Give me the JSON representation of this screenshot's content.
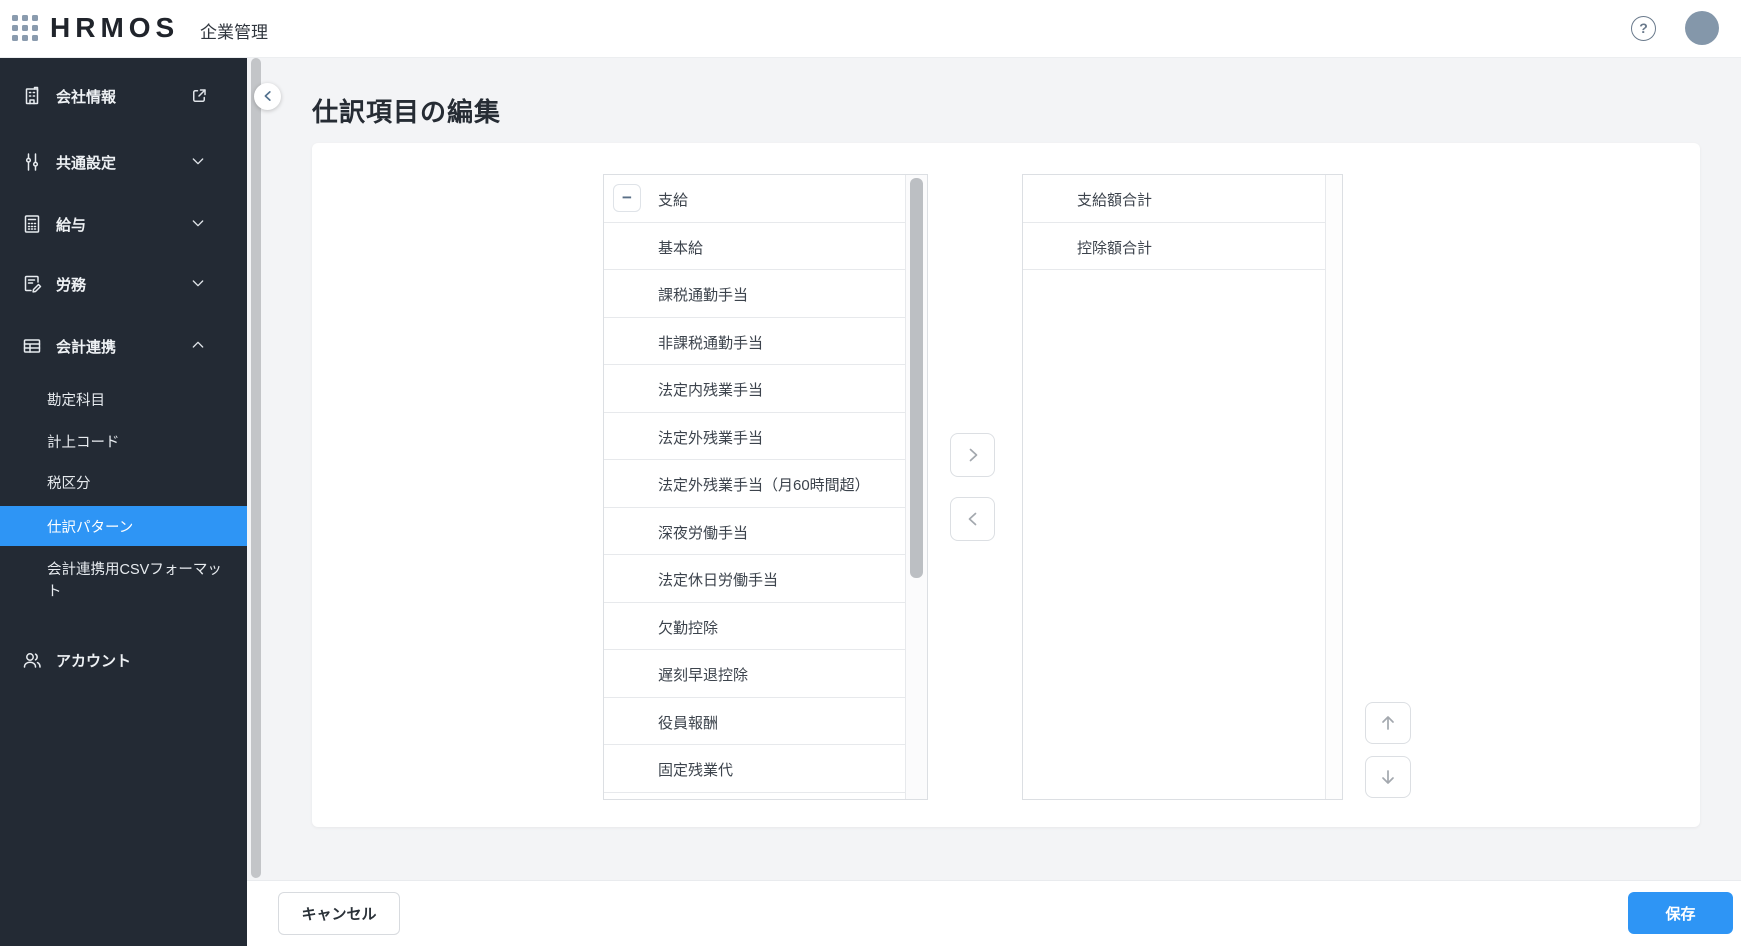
{
  "header": {
    "logo": "HRMOS",
    "product": "企業管理"
  },
  "sidebar": {
    "items": [
      {
        "label": "会社情報",
        "icon": "building-icon",
        "trailing": "external-link-icon"
      },
      {
        "label": "共通設定",
        "icon": "sliders-icon",
        "trailing": "chevron-down-icon"
      },
      {
        "label": "給与",
        "icon": "calculator-icon",
        "trailing": "chevron-down-icon"
      },
      {
        "label": "労務",
        "icon": "document-pen-icon",
        "trailing": "chevron-down-icon"
      },
      {
        "label": "会計連携",
        "icon": "table-icon",
        "trailing": "chevron-up-icon",
        "expanded": true
      }
    ],
    "sub_items": [
      {
        "label": "勘定科目",
        "active": false
      },
      {
        "label": "計上コード",
        "active": false
      },
      {
        "label": "税区分",
        "active": false
      },
      {
        "label": "仕訳パターン",
        "active": true
      },
      {
        "label": "会計連携用CSVフォーマット",
        "active": false
      }
    ],
    "account": {
      "label": "アカウント",
      "icon": "users-icon"
    }
  },
  "page": {
    "title": "仕訳項目の編集"
  },
  "left_list": {
    "items": [
      "支給",
      "基本給",
      "課税通勤手当",
      "非課税通勤手当",
      "法定内残業手当",
      "法定外残業手当",
      "法定外残業手当（月60時間超）",
      "深夜労働手当",
      "法定休日労働手当",
      "欠勤控除",
      "遅刻早退控除",
      "役員報酬",
      "固定残業代"
    ]
  },
  "right_list": {
    "items": [
      "支給額合計",
      "控除額合計"
    ]
  },
  "icons": {
    "collapse_row": "−",
    "help": "?"
  },
  "footer": {
    "cancel": "キャンセル",
    "save": "保存"
  },
  "colors": {
    "accent": "#2e95f5",
    "sidebar_bg": "#232a34",
    "avatar": "#8497aa"
  }
}
